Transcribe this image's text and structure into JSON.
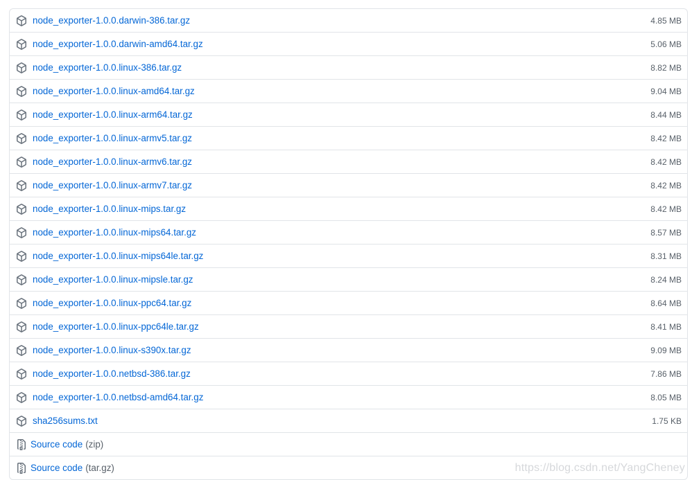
{
  "assets": [
    {
      "name": "node_exporter-1.0.0.darwin-386.tar.gz",
      "size": "4.85 MB",
      "icon": "package-icon"
    },
    {
      "name": "node_exporter-1.0.0.darwin-amd64.tar.gz",
      "size": "5.06 MB",
      "icon": "package-icon"
    },
    {
      "name": "node_exporter-1.0.0.linux-386.tar.gz",
      "size": "8.82 MB",
      "icon": "package-icon"
    },
    {
      "name": "node_exporter-1.0.0.linux-amd64.tar.gz",
      "size": "9.04 MB",
      "icon": "package-icon"
    },
    {
      "name": "node_exporter-1.0.0.linux-arm64.tar.gz",
      "size": "8.44 MB",
      "icon": "package-icon"
    },
    {
      "name": "node_exporter-1.0.0.linux-armv5.tar.gz",
      "size": "8.42 MB",
      "icon": "package-icon"
    },
    {
      "name": "node_exporter-1.0.0.linux-armv6.tar.gz",
      "size": "8.42 MB",
      "icon": "package-icon"
    },
    {
      "name": "node_exporter-1.0.0.linux-armv7.tar.gz",
      "size": "8.42 MB",
      "icon": "package-icon"
    },
    {
      "name": "node_exporter-1.0.0.linux-mips.tar.gz",
      "size": "8.42 MB",
      "icon": "package-icon"
    },
    {
      "name": "node_exporter-1.0.0.linux-mips64.tar.gz",
      "size": "8.57 MB",
      "icon": "package-icon"
    },
    {
      "name": "node_exporter-1.0.0.linux-mips64le.tar.gz",
      "size": "8.31 MB",
      "icon": "package-icon"
    },
    {
      "name": "node_exporter-1.0.0.linux-mipsle.tar.gz",
      "size": "8.24 MB",
      "icon": "package-icon"
    },
    {
      "name": "node_exporter-1.0.0.linux-ppc64.tar.gz",
      "size": "8.64 MB",
      "icon": "package-icon"
    },
    {
      "name": "node_exporter-1.0.0.linux-ppc64le.tar.gz",
      "size": "8.41 MB",
      "icon": "package-icon"
    },
    {
      "name": "node_exporter-1.0.0.linux-s390x.tar.gz",
      "size": "9.09 MB",
      "icon": "package-icon"
    },
    {
      "name": "node_exporter-1.0.0.netbsd-386.tar.gz",
      "size": "7.86 MB",
      "icon": "package-icon"
    },
    {
      "name": "node_exporter-1.0.0.netbsd-amd64.tar.gz",
      "size": "8.05 MB",
      "icon": "package-icon"
    },
    {
      "name": "sha256sums.txt",
      "size": "1.75 KB",
      "icon": "package-icon"
    }
  ],
  "source": [
    {
      "label": "Source code",
      "ext": "(zip)",
      "icon": "file-zip-icon"
    },
    {
      "label": "Source code",
      "ext": "(tar.gz)",
      "icon": "file-zip-icon"
    }
  ],
  "watermark": "https://blog.csdn.net/YangCheney",
  "colors": {
    "link": "#0366d6",
    "muted": "#586069",
    "border": "#e1e4e8"
  }
}
